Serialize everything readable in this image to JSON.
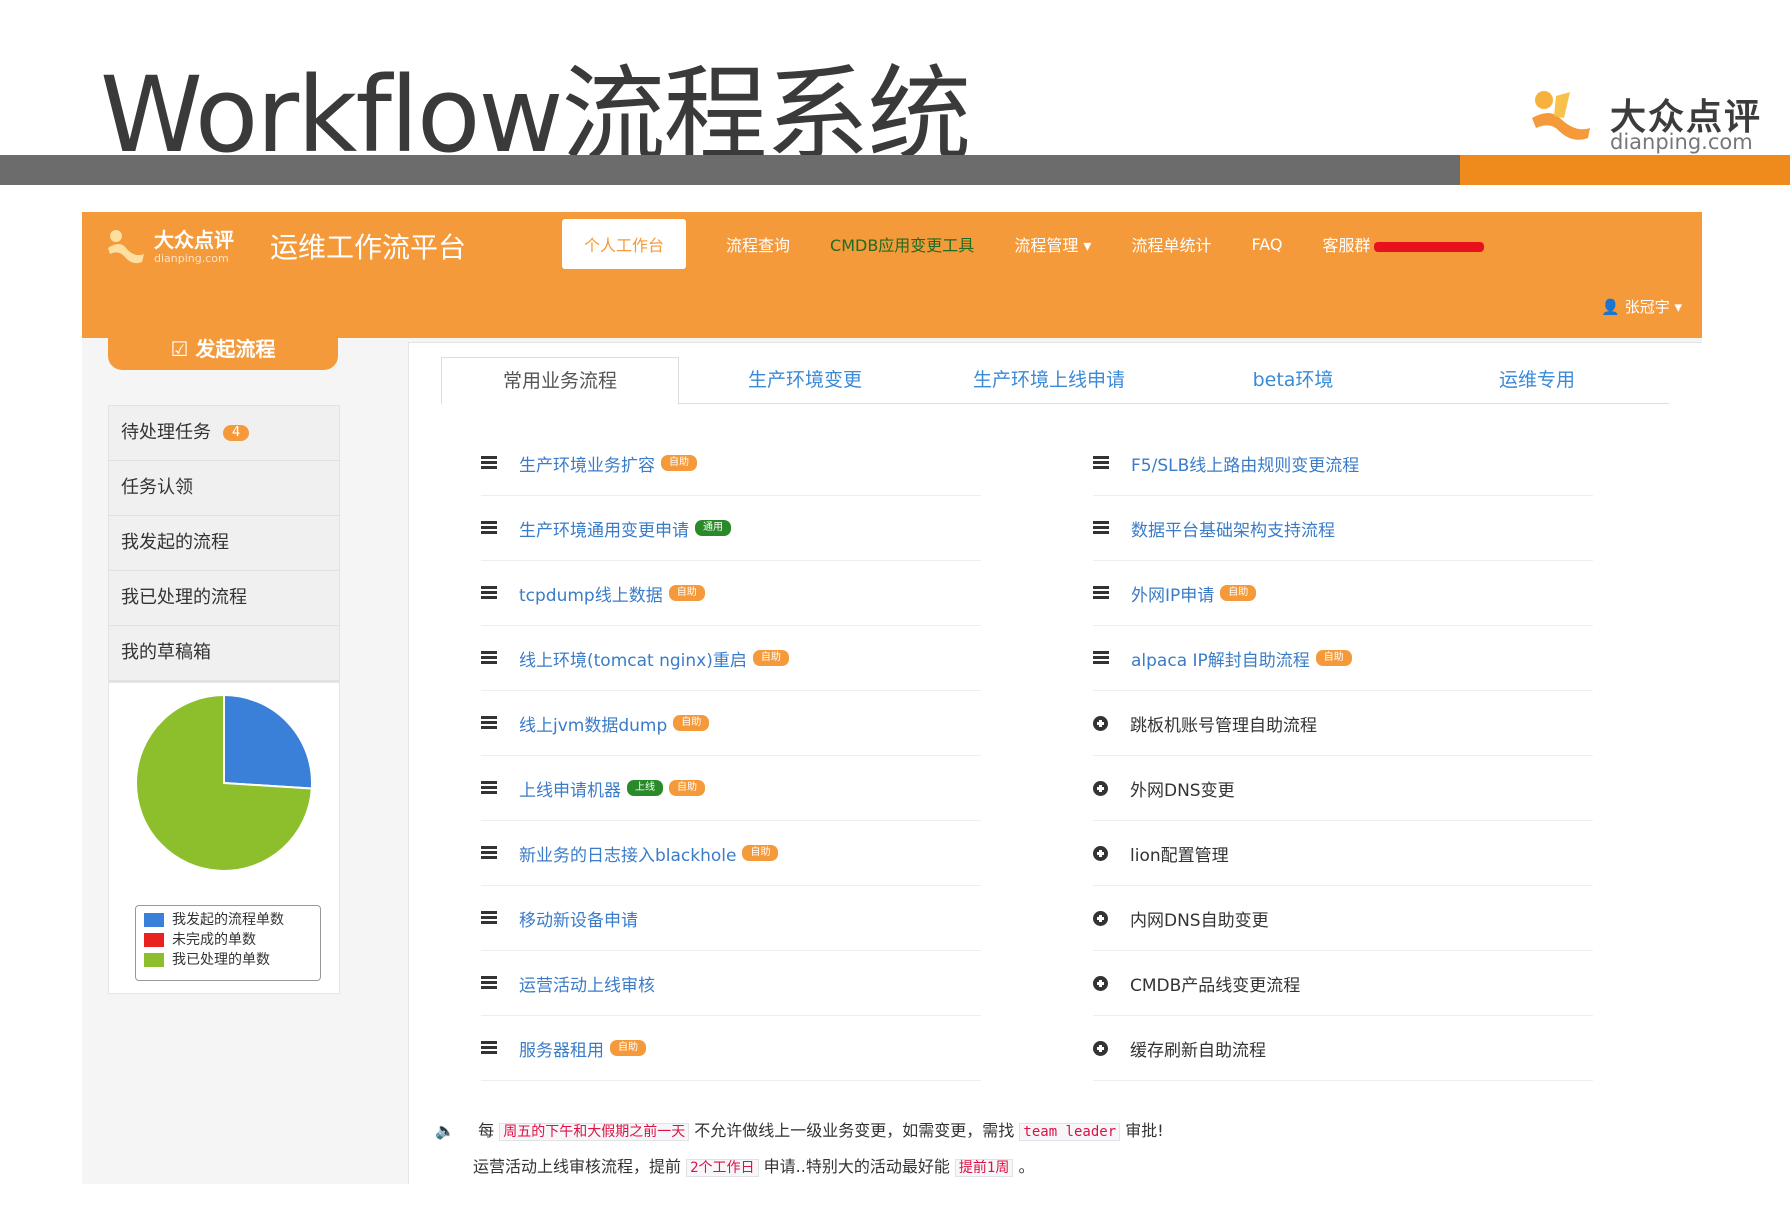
{
  "slide": {
    "title": "Workflow流程系统",
    "logo_cn": "大众点评",
    "logo_en": "dianping.com",
    "colors": {
      "gray_bar": "#6c6c6c",
      "orange_bar": "#ef8a1c"
    }
  },
  "app": {
    "logo_cn": "大众点评",
    "logo_en": "dianping.com",
    "platform_title": "运维工作流平台",
    "accent": "#f59a3b",
    "nav": [
      {
        "label": "个人工作台"
      },
      {
        "label": "流程查询"
      },
      {
        "label": "CMDB应用变更工具"
      },
      {
        "label": "流程管理 ▾"
      },
      {
        "label": "流程单统计"
      },
      {
        "label": "FAQ"
      },
      {
        "label": "客服群"
      }
    ],
    "user": "张冠宇 ▾",
    "start_button": "☑ 发起流程",
    "sidebar": [
      {
        "label": "待处理任务",
        "badge": "4"
      },
      {
        "label": "任务认领"
      },
      {
        "label": "我发起的流程"
      },
      {
        "label": "我已处理的流程"
      },
      {
        "label": "我的草稿箱"
      }
    ],
    "tabs": [
      "常用业务流程",
      "生产环境变更",
      "生产环境上线申请",
      "beta环境",
      "运维专用"
    ],
    "left_flows": [
      {
        "label": "生产环境业务扩容",
        "icon": "list-icon",
        "tags": [
          {
            "text": "自助",
            "color": "orange"
          }
        ]
      },
      {
        "label": "生产环境通用变更申请",
        "icon": "list-icon",
        "tags": [
          {
            "text": "通用",
            "color": "green"
          }
        ]
      },
      {
        "label": "tcpdump线上数据",
        "icon": "list-icon",
        "tags": [
          {
            "text": "自助",
            "color": "orange"
          }
        ]
      },
      {
        "label": "线上环境(tomcat nginx)重启",
        "icon": "list-icon",
        "tags": [
          {
            "text": "自助",
            "color": "orange"
          }
        ]
      },
      {
        "label": "线上jvm数据dump",
        "icon": "list-icon",
        "tags": [
          {
            "text": "自助",
            "color": "orange"
          }
        ]
      },
      {
        "label": "上线申请机器",
        "icon": "list-icon",
        "tags": [
          {
            "text": "上线",
            "color": "green"
          },
          {
            "text": "自助",
            "color": "orange"
          }
        ]
      },
      {
        "label": "新业务的日志接入blackhole",
        "icon": "list-icon",
        "tags": [
          {
            "text": "自助",
            "color": "orange"
          }
        ]
      },
      {
        "label": "移动新设备申请",
        "icon": "list-icon",
        "tags": []
      },
      {
        "label": "运营活动上线审核",
        "icon": "list-icon",
        "tags": []
      },
      {
        "label": "服务器租用",
        "icon": "list-icon",
        "tags": [
          {
            "text": "自助",
            "color": "orange"
          }
        ]
      }
    ],
    "right_flows": [
      {
        "label": "F5/SLB线上路由规则变更流程",
        "icon": "list-icon",
        "link": true,
        "tags": []
      },
      {
        "label": "数据平台基础架构支持流程",
        "icon": "list-icon",
        "link": true,
        "tags": []
      },
      {
        "label": "外网IP申请",
        "icon": "list-icon",
        "link": true,
        "tags": [
          {
            "text": "自助",
            "color": "orange"
          }
        ]
      },
      {
        "label": "alpaca IP解封自助流程",
        "icon": "list-icon",
        "link": true,
        "tags": [
          {
            "text": "自助",
            "color": "orange"
          }
        ]
      },
      {
        "label": "跳板机账号管理自助流程",
        "icon": "plus-circle-icon",
        "link": false,
        "tags": []
      },
      {
        "label": "外网DNS变更",
        "icon": "plus-circle-icon",
        "link": false,
        "tags": []
      },
      {
        "label": "lion配置管理",
        "icon": "plus-circle-icon",
        "link": false,
        "tags": []
      },
      {
        "label": "内网DNS自助变更",
        "icon": "plus-circle-icon",
        "link": false,
        "tags": []
      },
      {
        "label": "CMDB产品线变更流程",
        "icon": "plus-circle-icon",
        "link": false,
        "tags": []
      },
      {
        "label": "缓存刷新自助流程",
        "icon": "plus-circle-icon",
        "link": false,
        "tags": []
      }
    ],
    "notice": {
      "line1": [
        "每",
        "周五的下午和大假期之前一天",
        "不允许做线上一级业务变更，如需变更，需找",
        "team leader",
        "审批!"
      ],
      "line2": [
        "运营活动上线审核流程，提前",
        "2个工作日",
        "申请..特别大的活动最好能",
        "提前1周",
        "。"
      ]
    },
    "chart_data": {
      "type": "pie",
      "slices": [
        {
          "label": "我发起的流程单数",
          "value": 26,
          "color": "#3a7fd8"
        },
        {
          "label": "未完成的单数",
          "value": 0,
          "color": "#e8231f"
        },
        {
          "label": "我已处理的单数",
          "value": 74,
          "color": "#8cbf2b"
        }
      ],
      "legend_position": "bottom"
    }
  }
}
